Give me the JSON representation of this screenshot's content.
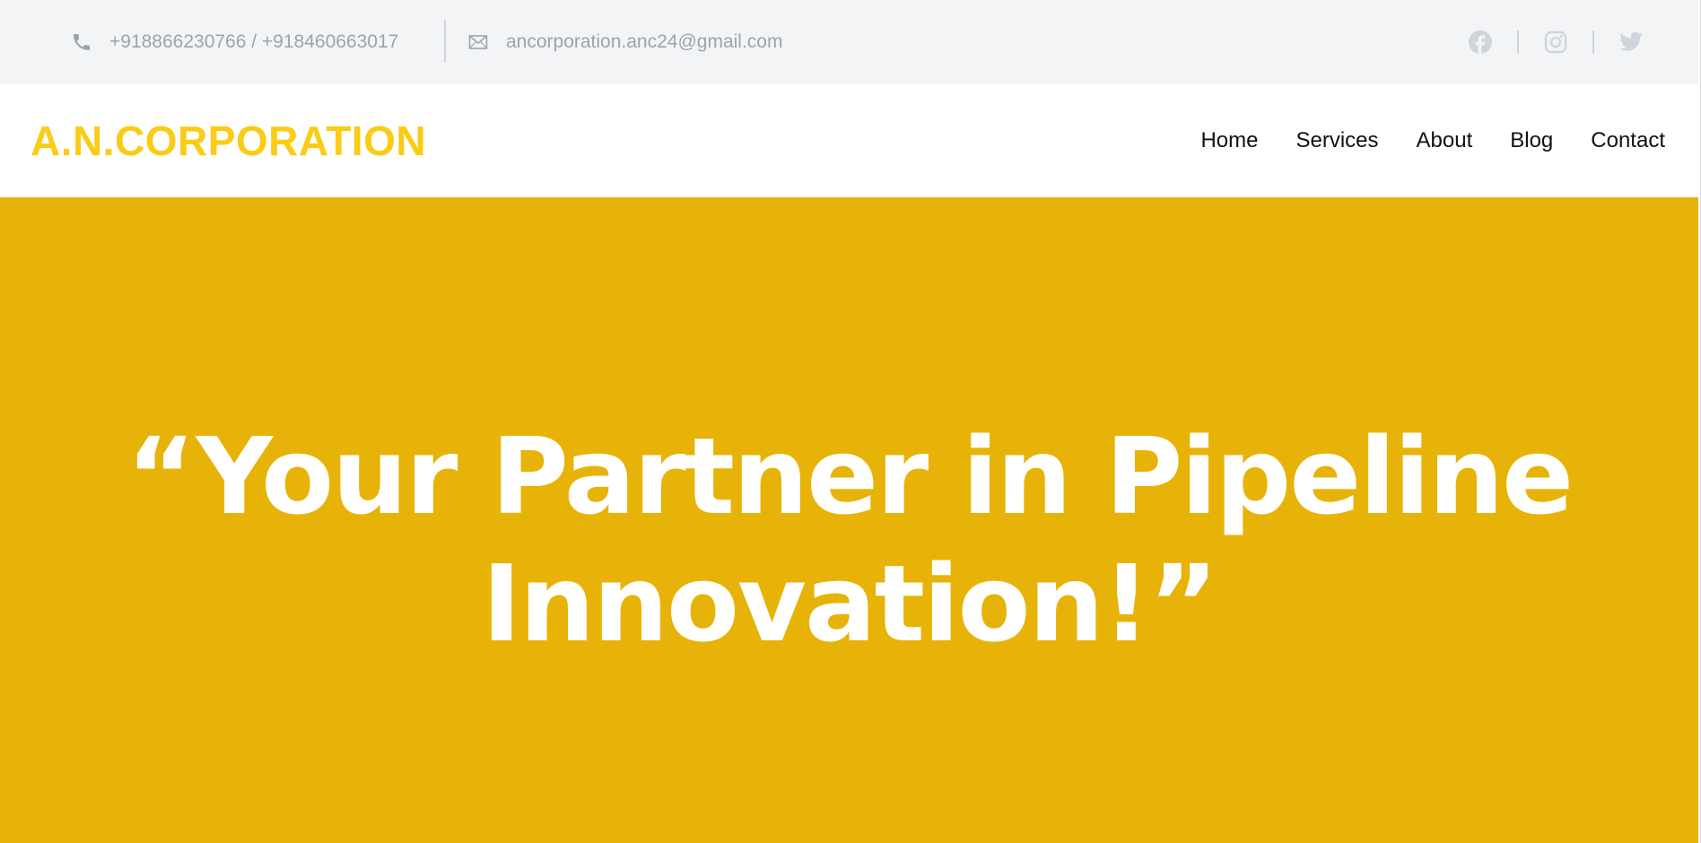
{
  "topbar": {
    "phone_icon": "phone-icon",
    "phone": "+918866230766 / +918460663017",
    "email_icon": "mail-icon",
    "email": "ancorporation.anc24@gmail.com",
    "socials": [
      "facebook-icon",
      "instagram-icon",
      "twitter-icon"
    ]
  },
  "header": {
    "logo": "A.N.CORPORATION",
    "nav": [
      "Home",
      "Services",
      "About",
      "Blog",
      "Contact"
    ]
  },
  "hero": {
    "headline": "“Your Partner in Pipeline Innovation!”"
  },
  "colors": {
    "brand_yellow": "#facc15",
    "hero_background": "#e8b308",
    "topbar_background": "#f3f4f6",
    "topbar_text": "#9ca3af",
    "nav_text": "#111111"
  }
}
